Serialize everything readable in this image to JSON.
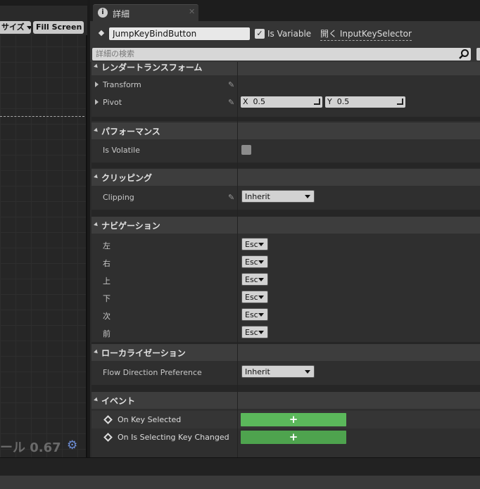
{
  "viewport": {
    "size_button": "サイズ",
    "fill_button": "Fill Screen",
    "scale_text": "ール 0.67"
  },
  "tab": {
    "title": "詳細",
    "close": "✕"
  },
  "header": {
    "widget_name": "JumpKeyBindButton",
    "is_variable_label": "Is Variable",
    "is_variable_checked": "✓",
    "open_link": "開く InputKeySelector"
  },
  "search": {
    "placeholder": "詳細の検索"
  },
  "categories": {
    "render_transform": "レンダートランスフォーム",
    "performance": "パフォーマンス",
    "clipping": "クリッピング",
    "navigation": "ナビゲーション",
    "localization": "ローカライゼーション",
    "event": "イベント"
  },
  "render_transform": {
    "transform_label": "Transform",
    "pivot_label": "Pivot",
    "pivot_x_prefix": "X",
    "pivot_x": "0.5",
    "pivot_y_prefix": "Y",
    "pivot_y": "0.5"
  },
  "performance": {
    "is_volatile_label": "Is Volatile"
  },
  "clipping": {
    "clipping_label": "Clipping",
    "clipping_value": "Inherit"
  },
  "navigation": {
    "rows": [
      {
        "label": "左",
        "value": "Esc"
      },
      {
        "label": "右",
        "value": "Esc"
      },
      {
        "label": "上",
        "value": "Esc"
      },
      {
        "label": "下",
        "value": "Esc"
      },
      {
        "label": "次",
        "value": "Esc"
      },
      {
        "label": "前",
        "value": "Esc"
      }
    ]
  },
  "localization": {
    "flow_label": "Flow Direction Preference",
    "flow_value": "Inherit"
  },
  "events": {
    "on_key_selected": "On Key Selected",
    "on_is_selecting_changed": "On Is Selecting Key Changed",
    "add_symbol": "+"
  },
  "colors": {
    "add_button": "#5bb85b",
    "accent_gear": "#6e8fd8"
  }
}
